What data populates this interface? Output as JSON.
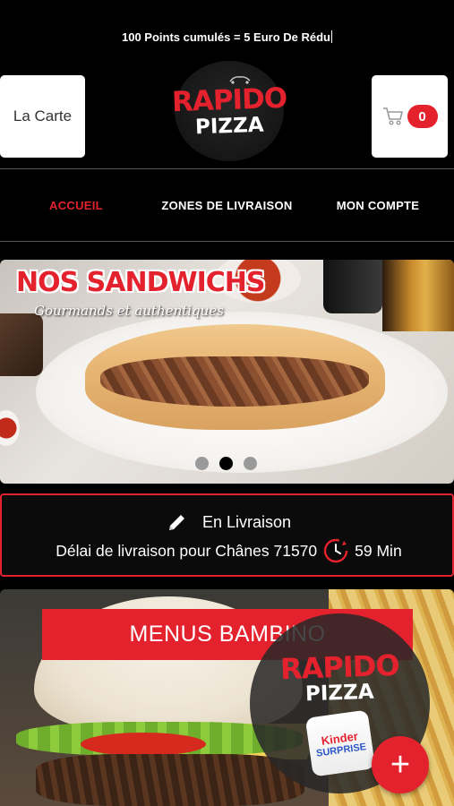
{
  "promo": {
    "text": "100 Points cumulés = 5 Euro De Rédu"
  },
  "header": {
    "carte_label": "La Carte",
    "cart_count": "0",
    "logo_line1": "RAPIDO",
    "logo_line2": "PIZZA"
  },
  "nav": {
    "items": [
      {
        "label": "ACCUEIL",
        "active": true
      },
      {
        "label": "ZONES DE LIVRAISON",
        "active": false
      },
      {
        "label": "MON COMPTE",
        "active": false
      }
    ]
  },
  "slider": {
    "title": "NOS SANDWICHS",
    "subtitle": "Gourmands et authentiques",
    "slide_count": 3,
    "active_index": 1
  },
  "delivery": {
    "mode_label": "En Livraison",
    "delay_text": "Délai de livraison pour Chânes 71570",
    "duration": "59 Min"
  },
  "menu_card": {
    "title": "MENUS BAMBINO"
  },
  "overlay": {
    "logo_line1": "RAPIDO",
    "logo_line2": "PIZZA",
    "product_brand": "Kinder",
    "product_name": "SURPRISE"
  },
  "fab": {
    "label": "+"
  },
  "colors": {
    "accent": "#e4222e",
    "background": "#000000",
    "white": "#ffffff"
  },
  "icons": {
    "cart": "cart-icon",
    "pencil": "pencil-icon",
    "clock": "clock-icon",
    "plus": "plus-icon"
  }
}
